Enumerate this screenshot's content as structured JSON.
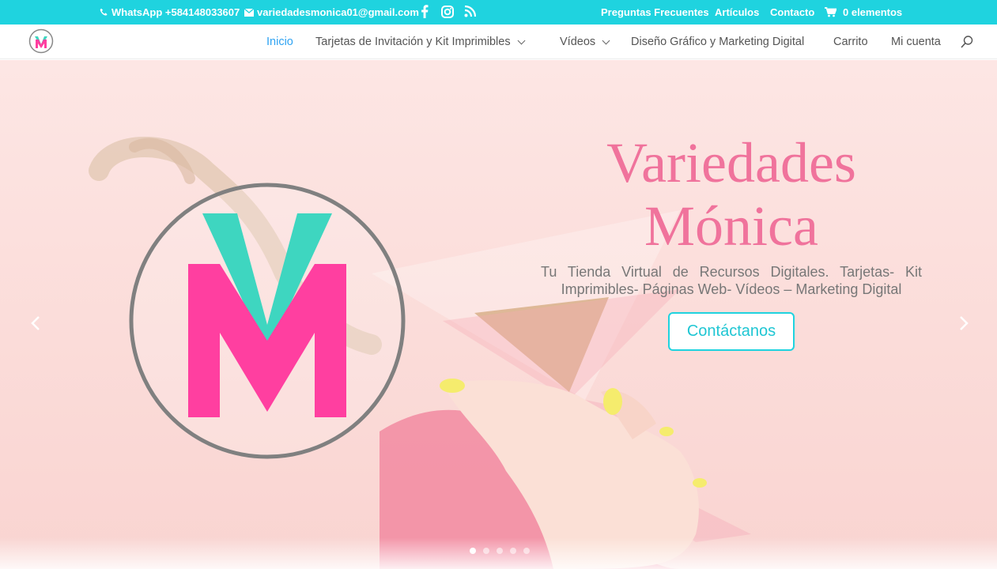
{
  "topbar": {
    "phone": "WhatsApp +584148033607",
    "email": "variedadesmonica01@gmail.com",
    "social_icons": [
      "facebook-icon",
      "instagram-icon",
      "rss-icon"
    ],
    "links": [
      "Preguntas Frecuentes",
      "Artículos",
      "Contacto"
    ],
    "cart": "0 elementos",
    "bg_color": "#1fd3df"
  },
  "nav": {
    "items": [
      {
        "label": "Inicio",
        "active": true
      },
      {
        "label": "Tarjetas de Invitación y Kit Imprimibles",
        "dropdown": true
      },
      {
        "label": "Vídeos",
        "dropdown": true
      },
      {
        "label": "Diseño Gráfico y Marketing Digital"
      },
      {
        "label": "Carrito"
      },
      {
        "label": "Mi cuenta"
      }
    ],
    "search_icon": "search-icon",
    "active_color": "#2ea3f2"
  },
  "hero": {
    "title_line1": "Variedades",
    "title_line2": "Mónica",
    "subtitle": "Tu Tienda Virtual de Recursos Digitales. Tarjetas- Kit Imprimibles- Páginas Web- Vídeos – Marketing Digital",
    "cta": "Contáctanos",
    "title_color": "#f0739c",
    "accent_color": "#1fd3df",
    "slides": 5,
    "current_slide": 1
  }
}
